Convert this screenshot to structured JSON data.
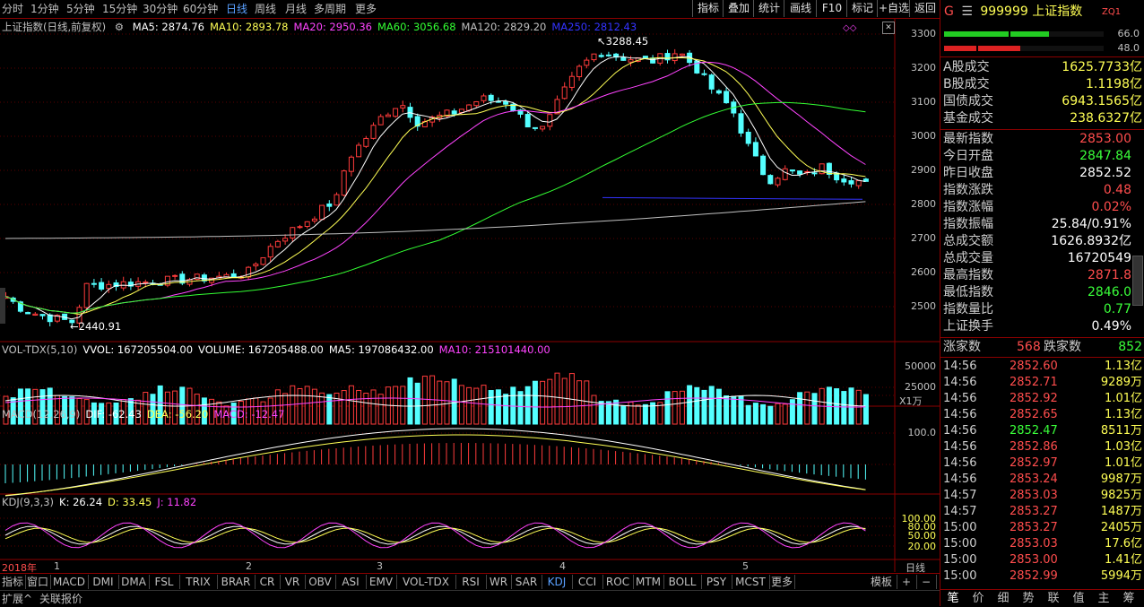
{
  "toolbar": {
    "periods": [
      "分时",
      "1分钟",
      "5分钟",
      "15分钟",
      "30分钟",
      "60分钟",
      "日线",
      "周线",
      "月线",
      "多周期",
      "更多"
    ],
    "active_period": "日线",
    "buttons": [
      "指标",
      "叠加",
      "统计",
      "画线",
      "F10",
      "标记",
      "+自选",
      "返回"
    ]
  },
  "chart_header": {
    "title": "上证指数(日线,前复权)",
    "ma": [
      {
        "label": "MA5: 2874.76",
        "color": "#ffffff"
      },
      {
        "label": "MA10: 2893.78",
        "color": "#ffff55"
      },
      {
        "label": "MA20: 2950.36",
        "color": "#ff44ff"
      },
      {
        "label": "MA60: 3056.68",
        "color": "#33ff33"
      },
      {
        "label": "MA120: 2829.20",
        "color": "#c0c0c0"
      },
      {
        "label": "MA250: 2812.43",
        "color": "#3333ff"
      }
    ]
  },
  "annotations": {
    "high": "3288.45",
    "low": "2440.91"
  },
  "price_axis": [
    "3300",
    "3200",
    "3100",
    "3000",
    "2900",
    "2800",
    "2700",
    "2600",
    "2500"
  ],
  "vol": {
    "header": [
      {
        "label": "VOL-TDX(5,10)",
        "color": "#c0c0c0"
      },
      {
        "label": "VVOL: 167205504.00",
        "color": "#ffffff"
      },
      {
        "label": "VOLUME: 167205488.00",
        "color": "#ffffff"
      },
      {
        "label": "MA5: 197086432.00",
        "color": "#ffffff"
      },
      {
        "label": "MA10: 215101440.00",
        "color": "#ff44ff"
      }
    ],
    "axis": [
      "50000",
      "25000"
    ],
    "unit": "X1万"
  },
  "macd": {
    "header": [
      {
        "label": "MACD(12,26,9)",
        "color": "#c0c0c0"
      },
      {
        "label": "DIF: -62.43",
        "color": "#ffffff"
      },
      {
        "label": "DEA: -56.20",
        "color": "#ffff55"
      },
      {
        "label": "MACD: -12.47",
        "color": "#ff44ff"
      }
    ],
    "axis": [
      "100.0"
    ]
  },
  "kdj": {
    "header": [
      {
        "label": "KDJ(9,3,3)",
        "color": "#c0c0c0"
      },
      {
        "label": "K: 26.24",
        "color": "#ffffff"
      },
      {
        "label": "D: 33.45",
        "color": "#ffff55"
      },
      {
        "label": "J: 11.82",
        "color": "#ff44ff"
      }
    ],
    "axis": [
      "100.00",
      "80.00",
      "50.00",
      "20.00"
    ]
  },
  "date_axis": {
    "year": "2018年",
    "months": [
      "1",
      "2",
      "3",
      "4",
      "5"
    ],
    "unit_label": "日线"
  },
  "indicator_tabs": [
    "指标",
    "窗口",
    "MACD",
    "DMI",
    "DMA",
    "FSL",
    "TRIX",
    "BRAR",
    "CR",
    "VR",
    "OBV",
    "ASI",
    "EMV",
    "VOL-TDX",
    "RSI",
    "WR",
    "SAR",
    "KDJ",
    "CCI",
    "ROC",
    "MTM",
    "BOLL",
    "PSY",
    "MCST",
    "更多"
  ],
  "active_indicator": "KDJ",
  "template_btn": "模板",
  "status_bar": [
    "扩展^",
    "关联报价"
  ],
  "panel": {
    "code": "999999",
    "name": "上证指数",
    "prefix": "G",
    "tag": "ZQ1",
    "bar_right_top": "66.0",
    "bar_right_bottom": "48.0",
    "bar_green_fraction": 0.66,
    "bar_red_fraction": 0.48,
    "turnover": [
      {
        "k": "A股成交",
        "v": "1625.7733亿"
      },
      {
        "k": "B股成交",
        "v": "1.1198亿"
      },
      {
        "k": "国债成交",
        "v": "6943.1565亿"
      },
      {
        "k": "基金成交",
        "v": "238.6327亿"
      }
    ],
    "quote": [
      {
        "k": "最新指数",
        "v": "2853.00",
        "c": "red"
      },
      {
        "k": "今日开盘",
        "v": "2847.84",
        "c": "green"
      },
      {
        "k": "昨日收盘",
        "v": "2852.52",
        "c": "white"
      },
      {
        "k": "指数涨跌",
        "v": "0.48",
        "c": "red"
      },
      {
        "k": "指数涨幅",
        "v": "0.02%",
        "c": "red"
      },
      {
        "k": "指数振幅",
        "v": "25.84/0.91%",
        "c": "white"
      },
      {
        "k": "总成交额",
        "v": "1626.8932亿",
        "c": "white"
      },
      {
        "k": "总成交量",
        "v": "16720549",
        "c": "white"
      },
      {
        "k": "最高指数",
        "v": "2871.8",
        "c": "red"
      },
      {
        "k": "最低指数",
        "v": "2846.0",
        "c": "green"
      },
      {
        "k": "指数量比",
        "v": "0.77",
        "c": "green"
      },
      {
        "k": "上证换手",
        "v": "0.49%",
        "c": "white"
      }
    ],
    "updown": {
      "up_label": "涨家数",
      "up": "568",
      "down_label": "跌家数",
      "down": "852"
    },
    "ticks": [
      {
        "t": "14:56",
        "p": "2852.60",
        "c": "red",
        "q": "1.13亿"
      },
      {
        "t": "14:56",
        "p": "2852.71",
        "c": "red",
        "q": "9289万"
      },
      {
        "t": "14:56",
        "p": "2852.92",
        "c": "red",
        "q": "1.01亿"
      },
      {
        "t": "14:56",
        "p": "2852.65",
        "c": "red",
        "q": "1.13亿"
      },
      {
        "t": "14:56",
        "p": "2852.47",
        "c": "green",
        "q": "8511万"
      },
      {
        "t": "14:56",
        "p": "2852.86",
        "c": "red",
        "q": "1.03亿"
      },
      {
        "t": "14:56",
        "p": "2852.97",
        "c": "red",
        "q": "1.01亿"
      },
      {
        "t": "14:56",
        "p": "2853.24",
        "c": "red",
        "q": "9987万"
      },
      {
        "t": "14:57",
        "p": "2853.03",
        "c": "red",
        "q": "9825万"
      },
      {
        "t": "14:57",
        "p": "2853.27",
        "c": "red",
        "q": "1487万"
      },
      {
        "t": "15:00",
        "p": "2853.27",
        "c": "red",
        "q": "2405万"
      },
      {
        "t": "15:00",
        "p": "2853.03",
        "c": "red",
        "q": "17.6亿"
      },
      {
        "t": "15:00",
        "p": "2853.00",
        "c": "red",
        "q": "1.41亿"
      },
      {
        "t": "15:00",
        "p": "2852.99",
        "c": "red",
        "q": "5994万"
      }
    ],
    "bottom_tabs": [
      "笔",
      "价",
      "细",
      "势",
      "联",
      "值",
      "主",
      "筹"
    ]
  }
}
